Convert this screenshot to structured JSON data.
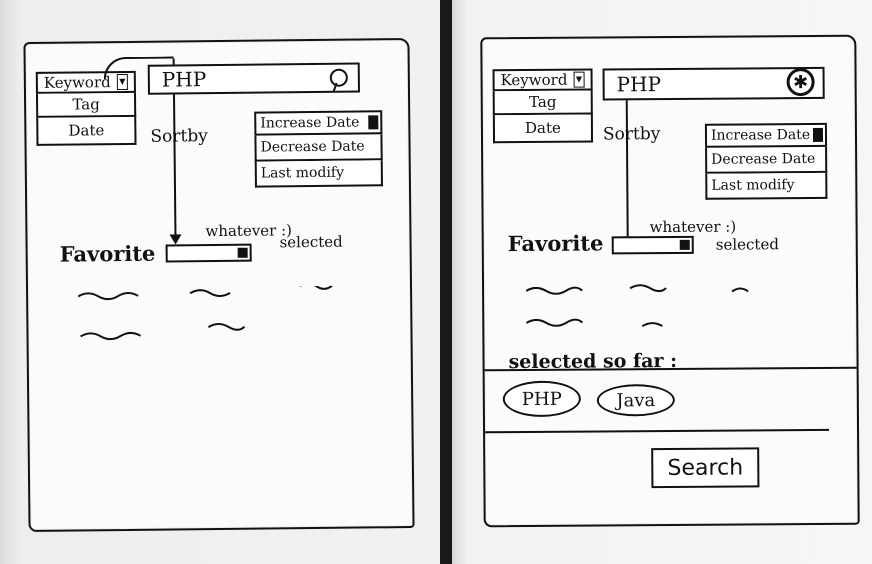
{
  "left": {
    "filter_menu": {
      "selected": "Keyword",
      "options": [
        "Tag",
        "Date"
      ]
    },
    "search": {
      "value": "PHP"
    },
    "sort": {
      "label": "Sortby",
      "selected": "Increase Date",
      "options": [
        "Decrease Date",
        "Last modify"
      ]
    },
    "favorite": {
      "label": "Favorite",
      "note_top": "whatever :)",
      "note_right": "selected"
    }
  },
  "right": {
    "filter_menu": {
      "selected": "Keyword",
      "options": [
        "Tag",
        "Date"
      ]
    },
    "search": {
      "value": "PHP"
    },
    "sort": {
      "label": "Sortby",
      "selected": "Increase Date",
      "options": [
        "Decrease Date",
        "Last modify"
      ]
    },
    "favorite": {
      "label": "Favorite",
      "note_top": "whatever :)",
      "note_right": "selected"
    },
    "selected_so_far": {
      "label": "selected so far :",
      "tags": [
        "PHP",
        "Java"
      ]
    },
    "search_button": "Search"
  },
  "icons": {
    "left_search_icon": "pencil-icon",
    "right_search_icon": "circle-button-icon"
  }
}
